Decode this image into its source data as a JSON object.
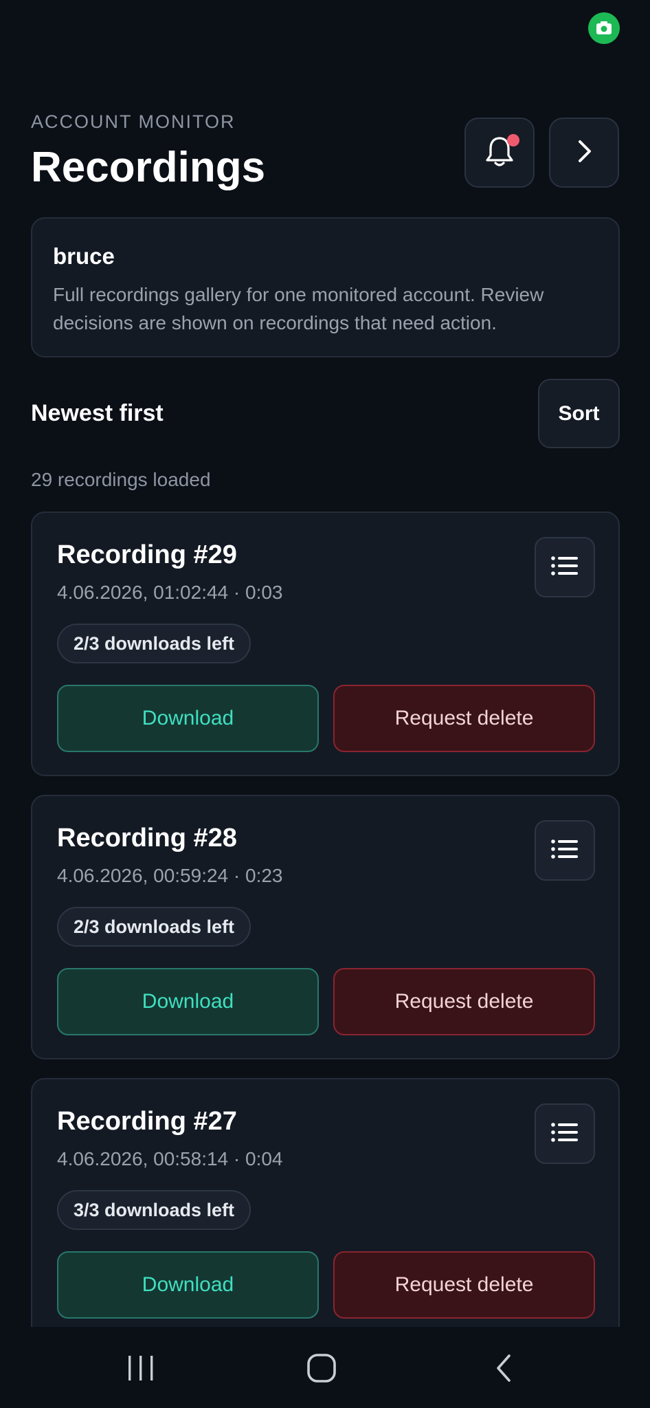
{
  "colors": {
    "background": "#0b0f16",
    "card": "#141a24",
    "accent_teal": "#3fe0c0",
    "danger": "#8a2530",
    "notification_dot": "#f05a6e",
    "status_camera": "#1db954"
  },
  "status_bar": {
    "icon": "camera-icon"
  },
  "header": {
    "eyebrow": "ACCOUNT MONITOR",
    "title": "Recordings",
    "bell_icon": "bell-icon",
    "forward_icon": "chevron-right-icon"
  },
  "account": {
    "name": "bruce",
    "description": "Full recordings gallery for one monitored account. Review decisions are shown on recordings that need action."
  },
  "sort": {
    "label": "Newest first",
    "button_label": "Sort"
  },
  "count_label": "29 recordings loaded",
  "recordings": [
    {
      "title": "Recording #29",
      "meta": "4.06.2026, 01:02:44 · 0:03",
      "badge": "2/3 downloads left",
      "download_label": "Download",
      "delete_label": "Request delete"
    },
    {
      "title": "Recording #28",
      "meta": "4.06.2026, 00:59:24 · 0:23",
      "badge": "2/3 downloads left",
      "download_label": "Download",
      "delete_label": "Request delete"
    },
    {
      "title": "Recording #27",
      "meta": "4.06.2026, 00:58:14 · 0:04",
      "badge": "3/3 downloads left",
      "download_label": "Download",
      "delete_label": "Request delete"
    }
  ],
  "nav": {
    "recents_icon": "recents-icon",
    "home_icon": "home-icon",
    "back_icon": "back-icon"
  }
}
